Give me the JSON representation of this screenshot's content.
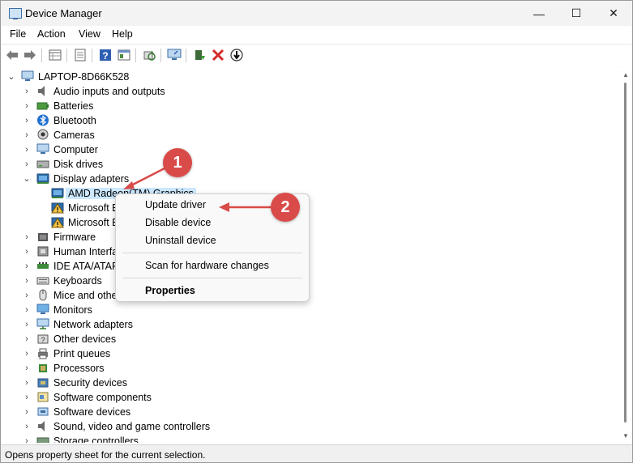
{
  "window": {
    "title": "Device Manager",
    "min": "—",
    "max": "☐",
    "close": "✕"
  },
  "menu": [
    "File",
    "Action",
    "View",
    "Help"
  ],
  "toolbar": {
    "buttons": [
      "back-arrow-icon",
      "forward-arrow-icon",
      "properties-grid-icon",
      "document-icon",
      "help-icon",
      "console-icon",
      "scan-hardware-icon",
      "monitor-icon",
      "add-driver-icon",
      "uninstall-x-icon",
      "download-circle-icon"
    ]
  },
  "tree": {
    "root": "LAPTOP-8D66K528",
    "items": [
      {
        "label": "Audio inputs and outputs",
        "icon": "speaker-icon",
        "expander": "›"
      },
      {
        "label": "Batteries",
        "icon": "battery-icon",
        "expander": "›"
      },
      {
        "label": "Bluetooth",
        "icon": "bluetooth-icon",
        "expander": "›"
      },
      {
        "label": "Cameras",
        "icon": "camera-icon",
        "expander": "›"
      },
      {
        "label": "Computer",
        "icon": "computer-icon",
        "expander": "›"
      },
      {
        "label": "Disk drives",
        "icon": "disk-icon",
        "expander": "›"
      },
      {
        "label": "Display adapters",
        "icon": "display-adapter-icon",
        "expander": "⌄"
      },
      {
        "label": "AMD Radeon(TM) Graphics",
        "icon": "display-adapter-icon",
        "child": true,
        "selected": true
      },
      {
        "label": "Microsoft Basic Display Adapter",
        "icon": "warning-icon",
        "child": true
      },
      {
        "label": "Microsoft Basic Render Driver",
        "icon": "warning-icon",
        "child": true
      },
      {
        "label": "Firmware",
        "icon": "firmware-icon",
        "expander": "›"
      },
      {
        "label": "Human Interface Devices",
        "icon": "hid-icon",
        "expander": "›"
      },
      {
        "label": "IDE ATA/ATAPI controllers",
        "icon": "ide-icon",
        "expander": "›"
      },
      {
        "label": "Keyboards",
        "icon": "keyboard-icon",
        "expander": "›"
      },
      {
        "label": "Mice and other pointing devices",
        "icon": "mouse-icon",
        "expander": "›"
      },
      {
        "label": "Monitors",
        "icon": "monitor-icon",
        "expander": "›"
      },
      {
        "label": "Network adapters",
        "icon": "network-icon",
        "expander": "›"
      },
      {
        "label": "Other devices",
        "icon": "other-devices-icon",
        "expander": "›"
      },
      {
        "label": "Print queues",
        "icon": "printer-icon",
        "expander": "›"
      },
      {
        "label": "Processors",
        "icon": "processor-icon",
        "expander": "›"
      },
      {
        "label": "Security devices",
        "icon": "security-icon",
        "expander": "›"
      },
      {
        "label": "Software components",
        "icon": "software-component-icon",
        "expander": "›"
      },
      {
        "label": "Software devices",
        "icon": "software-device-icon",
        "expander": "›"
      },
      {
        "label": "Sound, video and game controllers",
        "icon": "sound-icon",
        "expander": "›"
      },
      {
        "label": "Storage controllers",
        "icon": "storage-icon",
        "expander": "›"
      }
    ]
  },
  "context_menu": {
    "items": [
      "Update driver",
      "Disable device",
      "Uninstall device",
      "Scan for hardware changes",
      "Properties"
    ]
  },
  "annotations": {
    "one": "1",
    "two": "2"
  },
  "status": {
    "text": "Opens property sheet for the current selection."
  },
  "colors": {
    "accent_red": "#d94b49",
    "selection": "#cce8ff",
    "icon_blue": "#3b6ea5"
  }
}
